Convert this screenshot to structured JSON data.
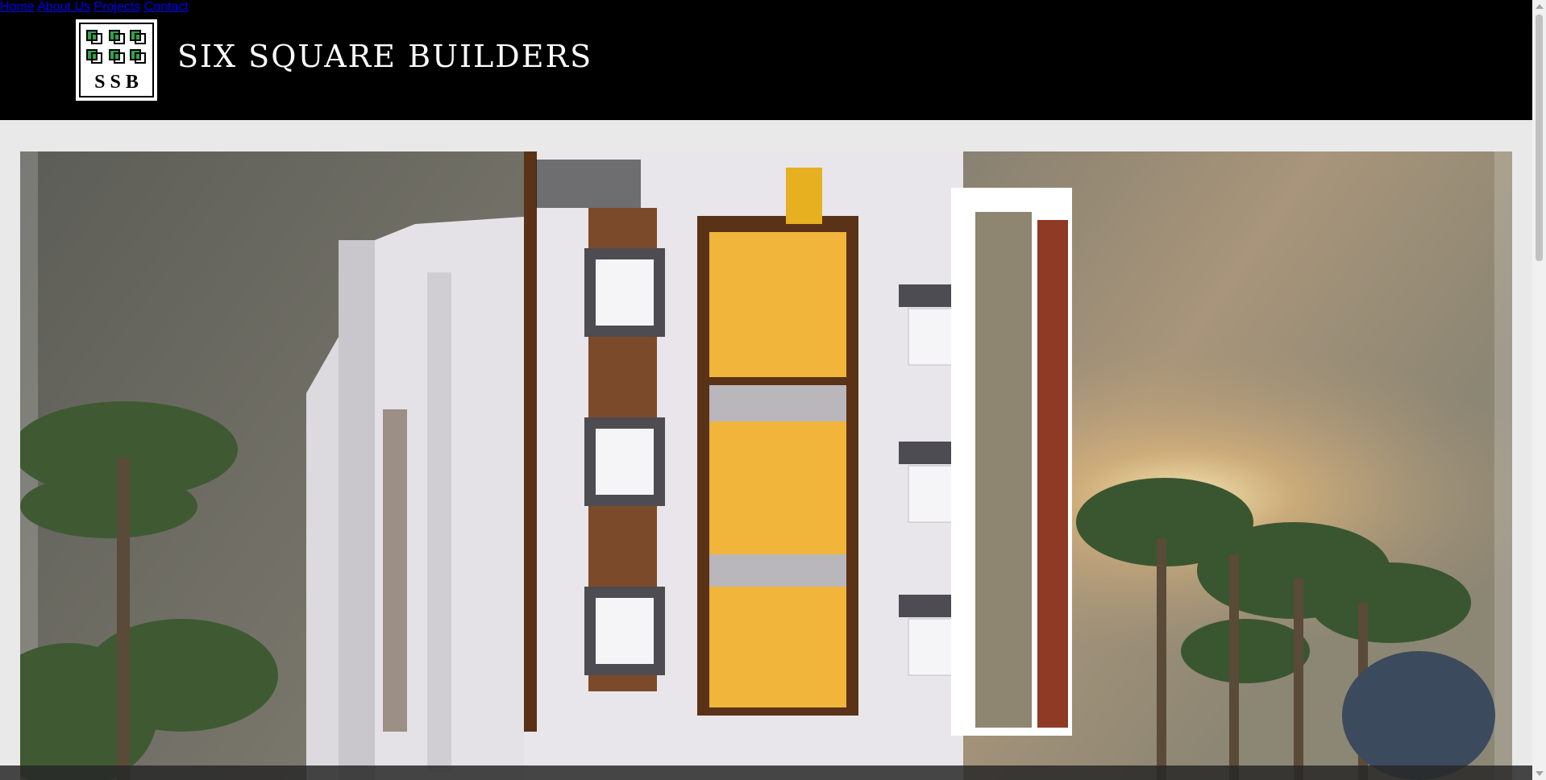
{
  "header": {
    "brand": "SIX SQUARE BUILDERS",
    "logo_text": "SSB",
    "logo_square_color": "#2ea44a"
  },
  "nav": {
    "items": [
      {
        "label": "Home"
      },
      {
        "label": "About Us"
      },
      {
        "label": "Projects"
      },
      {
        "label": "Contact"
      }
    ]
  },
  "hero": {
    "subject": "apartment-building-rendering",
    "colors": {
      "wall": "#e4e2e6",
      "accent_yellow": "#f0b53a",
      "wood": "#6b3a1d",
      "sky_warm": "#c4a06a"
    }
  }
}
